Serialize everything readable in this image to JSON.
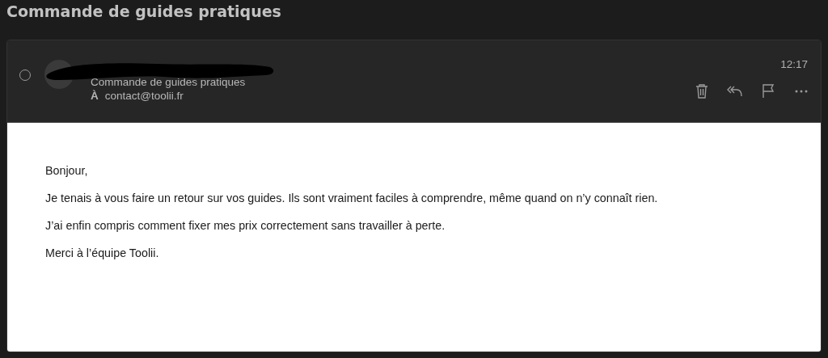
{
  "title": "Commande de guides pratiques",
  "message": {
    "selected": false,
    "subject": "Commande de guides pratiques",
    "to_label": "À",
    "to": "contact@toolii.fr",
    "time": "12:17",
    "actions": [
      {
        "kind": "delete"
      },
      {
        "kind": "reply-all"
      },
      {
        "kind": "flag"
      },
      {
        "kind": "more"
      }
    ],
    "body": [
      "Bonjour,",
      "Je tenais à vous faire un retour sur vos guides. Ils sont vraiment faciles à comprendre, même quand on n’y connaît rien.",
      "J’ai enfin compris comment fixer mes prix correctement sans travailler à perte.",
      "Merci à l’équipe Toolii."
    ]
  }
}
